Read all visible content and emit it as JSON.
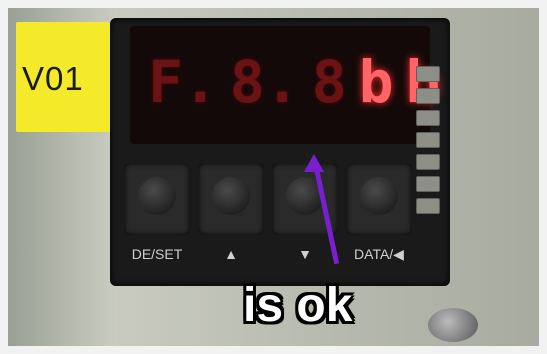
{
  "unit_label": "V01",
  "display": {
    "dim_digits": [
      "F.",
      "8.",
      "8"
    ],
    "bright_digits": [
      "b",
      "b"
    ]
  },
  "keypad": {
    "labels": [
      "DE/SET",
      "▲",
      "▼",
      "DATA/◀"
    ]
  },
  "caption": "is ok"
}
